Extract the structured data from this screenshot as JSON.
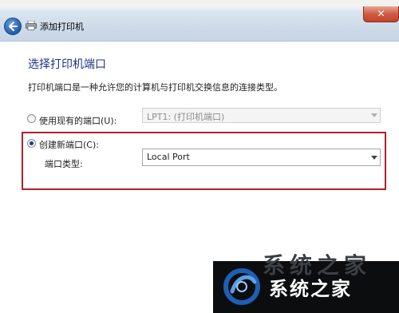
{
  "window": {
    "title": "添加打印机"
  },
  "page": {
    "heading": "选择打印机端口",
    "description": "打印机端口是一种允许您的计算机与打印机交换信息的连接类型。"
  },
  "existing_port": {
    "label": "使用现有的端口(U):",
    "selected": false,
    "combo_value": "LPT1: (打印机端口)",
    "enabled": false
  },
  "new_port": {
    "label": "创建新端口(C):",
    "selected": true,
    "type_label": "端口类型:",
    "combo_value": "Local Port"
  },
  "watermark": {
    "text": "系统之家",
    "ghost_text": "系统之家"
  },
  "colors": {
    "highlight_box": "#b0202a",
    "heading": "#1e3287",
    "logo_background": "#0b0d0f"
  },
  "icons": {
    "back": "back-arrow-icon",
    "printer": "printer-icon",
    "close": "close-icon",
    "dropdown": "chevron-down-icon",
    "logo": "logo-icon"
  }
}
